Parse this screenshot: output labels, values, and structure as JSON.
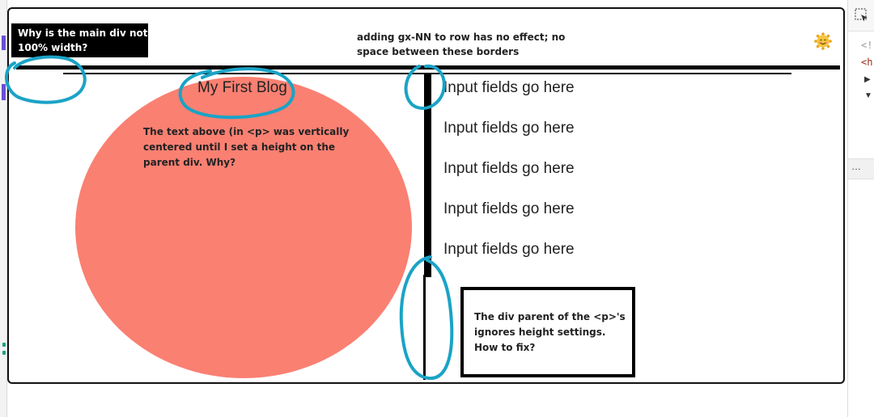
{
  "annotations": {
    "main_div_question": "Why is the main div not 100% width?",
    "gutter_note": "adding gx-NN to row has no effect; no space between these borders",
    "vertical_center_note": "The text above (in <p> was vertically centered until I set a height on the parent div. Why?",
    "height_note": "The div parent of the <p>'s ignores height settings. How to fix?"
  },
  "page": {
    "blog_title": "My First Blog",
    "input_rows": [
      "Input fields go here",
      "Input fields go here",
      "Input fields go here",
      "Input fields go here",
      "Input fields go here"
    ]
  },
  "devtools": {
    "line1": "<!",
    "line2": "<h",
    "overflow": "…"
  },
  "icons": {
    "emoji": "smiling-face-icon",
    "inspect": "inspect-element-icon"
  },
  "colors": {
    "circle": "#fa8072",
    "scribble": "#1aa3c6",
    "gutter_mark": "#6b4fd6"
  }
}
